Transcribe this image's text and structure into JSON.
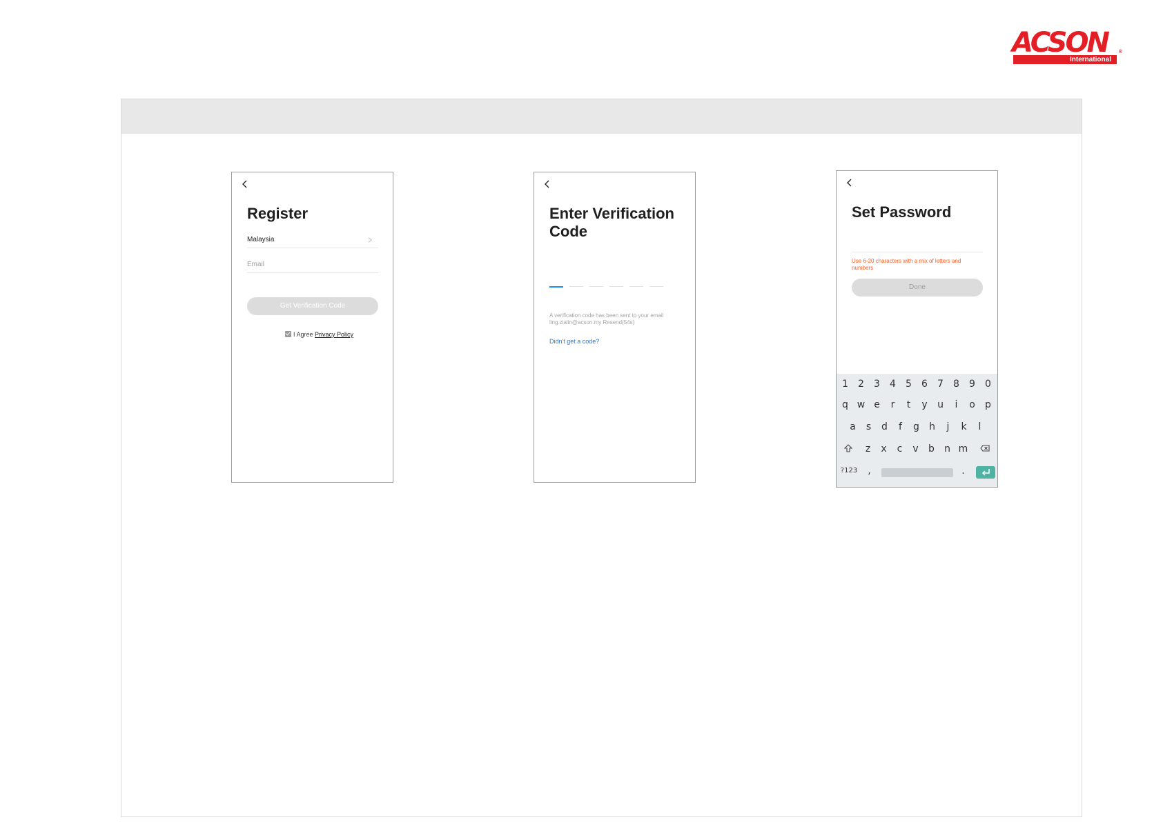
{
  "brand": {
    "name": "ACSON",
    "subtitle": "International",
    "registered": "®",
    "color": "#e31e24"
  },
  "register": {
    "back_icon": "chevron-left-icon",
    "title": "Register",
    "country": "Malaysia",
    "email_placeholder": "Email",
    "button": "Get Verification Code",
    "agree_text": "I Agree",
    "policy_link": "Privacy Policy",
    "agree_checked": true
  },
  "verify": {
    "back_icon": "chevron-left-icon",
    "title_line1": "Enter Verification",
    "title_line2": "Code",
    "code_length": 6,
    "info_line1": "A verification code has been sent to your email",
    "info_line2": "ling.zialin@acson.my  Resend(54s)",
    "link": "Didn't get a code?",
    "active_color": "#1890ff",
    "link_color": "#1f7ae0"
  },
  "password": {
    "back_icon": "chevron-left-icon",
    "title": "Set Password",
    "hint": "Use 6-20 characters with a mix of letters and numbers",
    "hint_color": "#ff5a1f",
    "button": "Done"
  },
  "keyboard": {
    "row1": [
      "1",
      "2",
      "3",
      "4",
      "5",
      "6",
      "7",
      "8",
      "9",
      "0"
    ],
    "row2": [
      "q",
      "w",
      "e",
      "r",
      "t",
      "y",
      "u",
      "i",
      "o",
      "p"
    ],
    "row3": [
      "a",
      "s",
      "d",
      "f",
      "g",
      "h",
      "j",
      "k",
      "l"
    ],
    "row4": [
      "z",
      "x",
      "c",
      "v",
      "b",
      "n",
      "m"
    ],
    "symbols_key": "?123",
    "comma_key": ",",
    "period_key": ".",
    "shift_icon": "shift-icon",
    "backspace_icon": "backspace-icon",
    "enter_icon": "enter-icon",
    "enter_color": "#4fb3a3"
  }
}
